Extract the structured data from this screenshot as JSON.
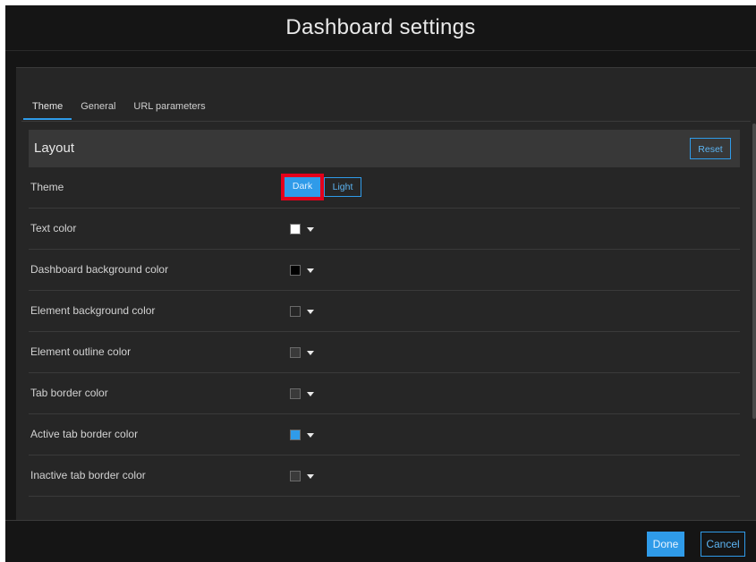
{
  "dialog": {
    "title": "Dashboard settings"
  },
  "tabs": [
    {
      "label": "Theme",
      "active": true
    },
    {
      "label": "General",
      "active": false
    },
    {
      "label": "URL parameters",
      "active": false
    }
  ],
  "section": {
    "title": "Layout",
    "reset_label": "Reset"
  },
  "theme_row": {
    "label": "Theme",
    "options": [
      {
        "label": "Dark",
        "selected": true
      },
      {
        "label": "Light",
        "selected": false
      }
    ]
  },
  "color_rows": [
    {
      "label": "Text color",
      "color": "#ffffff"
    },
    {
      "label": "Dashboard background color",
      "color": "#000000"
    },
    {
      "label": "Element background color",
      "color": "#262626"
    },
    {
      "label": "Element outline color",
      "color": "#3a3a3a"
    },
    {
      "label": "Tab border color",
      "color": "#3a3a3a"
    },
    {
      "label": "Active tab border color",
      "color": "#2f9be9"
    },
    {
      "label": "Inactive tab border color",
      "color": "#3a3a3a"
    }
  ],
  "footer": {
    "done_label": "Done",
    "cancel_label": "Cancel"
  },
  "colors": {
    "accent": "#2f9be9",
    "highlight": "#e4001b",
    "background": "#151515",
    "panel": "#262626"
  },
  "icons": {
    "dropdown": "caret-down-icon"
  }
}
